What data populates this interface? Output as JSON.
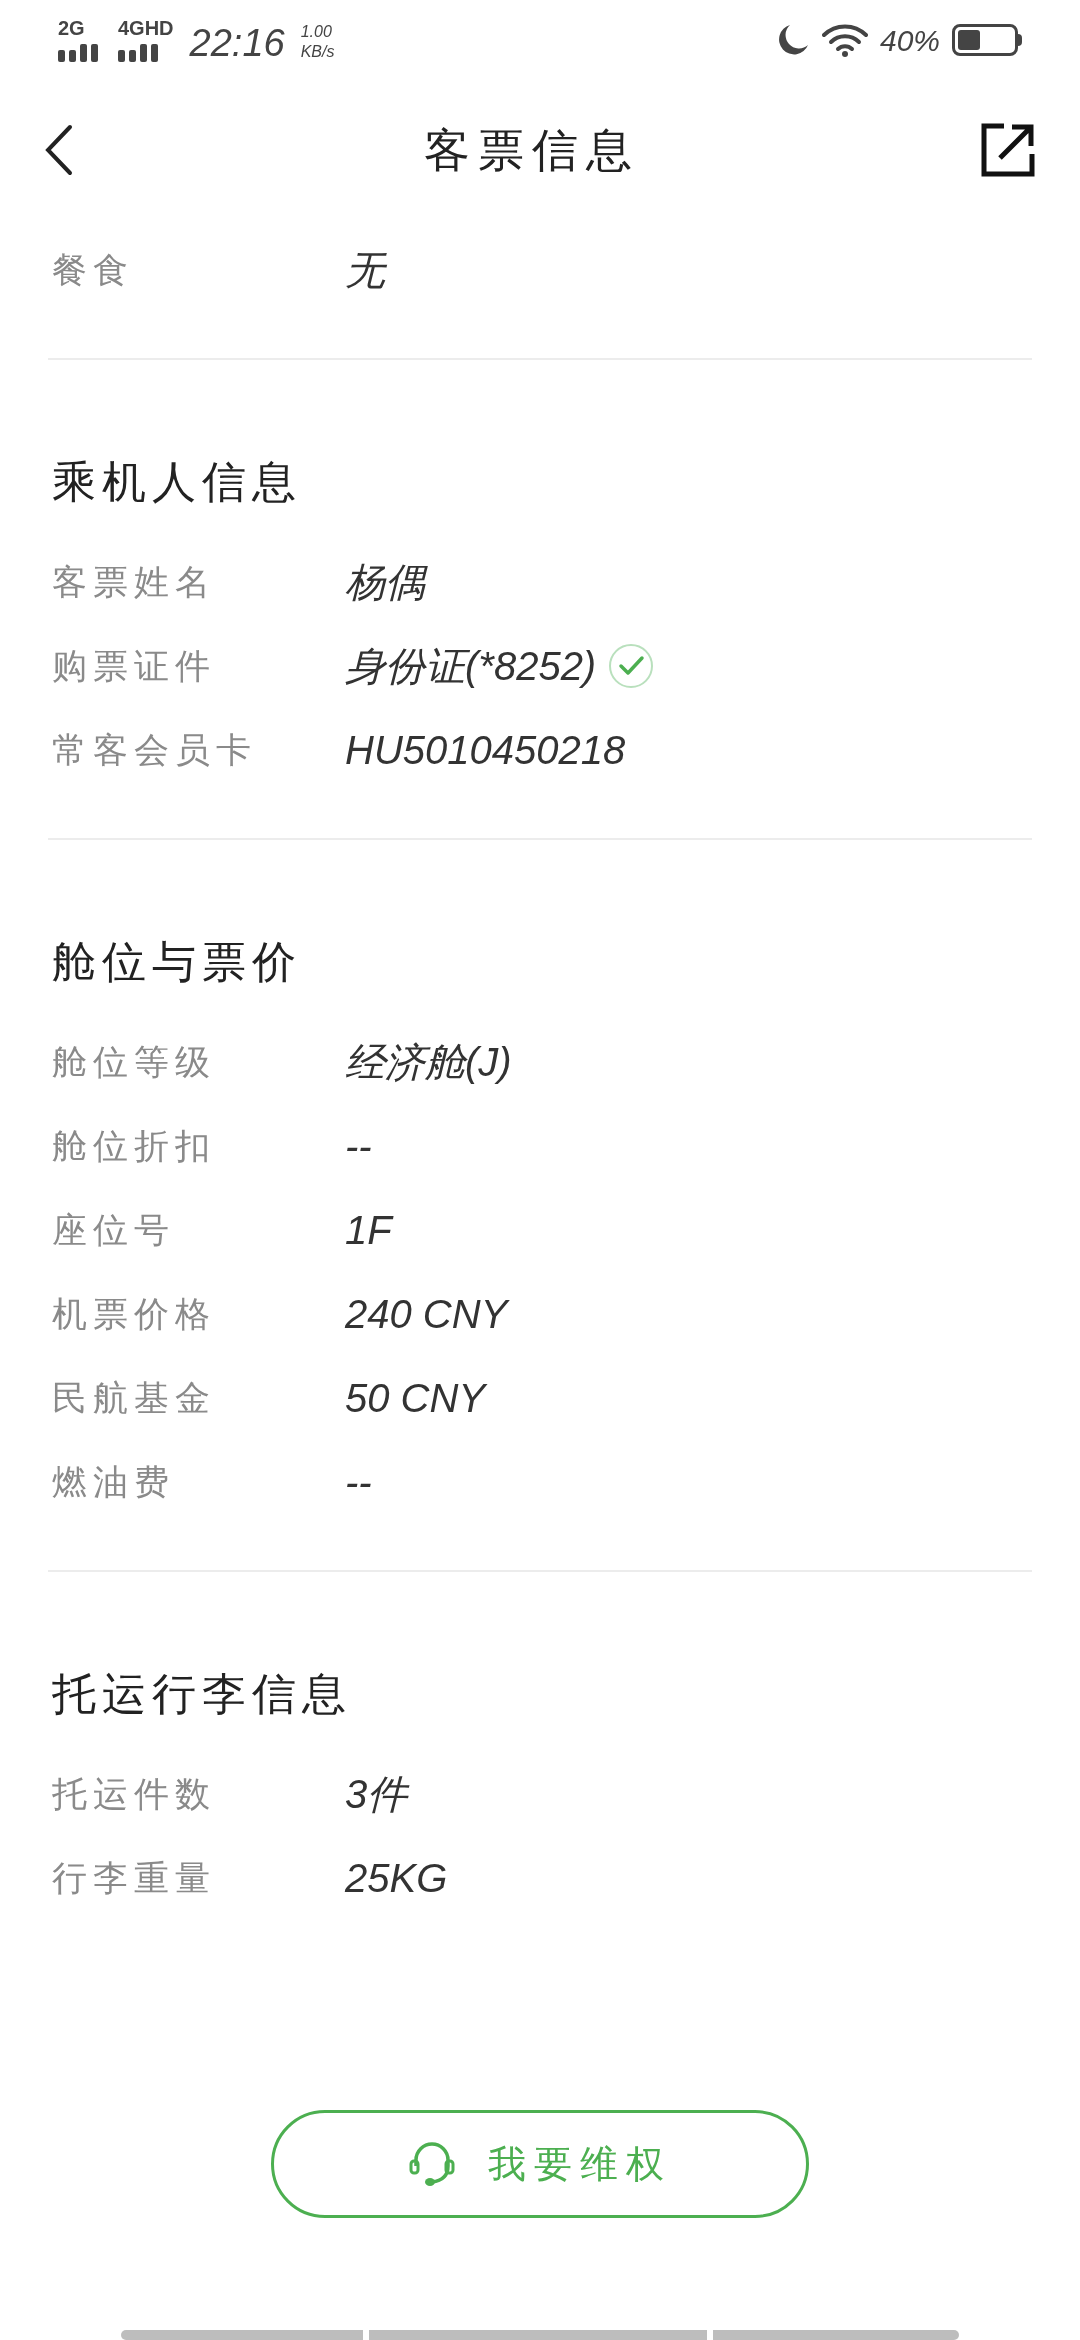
{
  "status_bar": {
    "network_1": "2G",
    "network_2": "4GHD",
    "time": "22:16",
    "speed_value": "1.00",
    "speed_unit": "KB/s",
    "battery": "40%"
  },
  "header": {
    "title": "客票信息"
  },
  "sections": [
    {
      "rows": [
        {
          "label": "餐食",
          "value": "无",
          "verified": false
        }
      ]
    },
    {
      "title": "乘机人信息",
      "rows": [
        {
          "label": "客票姓名",
          "value": "杨偶",
          "verified": false
        },
        {
          "label": "购票证件",
          "value": "身份证(*8252)",
          "verified": true
        },
        {
          "label": "常客会员卡",
          "value": "HU5010450218",
          "verified": false
        }
      ]
    },
    {
      "title": "舱位与票价",
      "rows": [
        {
          "label": "舱位等级",
          "value": "经济舱(J)",
          "verified": false
        },
        {
          "label": "舱位折扣",
          "value": "--",
          "verified": false
        },
        {
          "label": "座位号",
          "value": "1F",
          "verified": false
        },
        {
          "label": "机票价格",
          "value": "240 CNY",
          "verified": false
        },
        {
          "label": "民航基金",
          "value": "50 CNY",
          "verified": false
        },
        {
          "label": "燃油费",
          "value": "--",
          "verified": false
        }
      ]
    },
    {
      "title": "托运行李信息",
      "rows": [
        {
          "label": "托运件数",
          "value": "3件",
          "verified": false
        },
        {
          "label": "行李重量",
          "value": "25KG",
          "verified": false
        }
      ]
    }
  ],
  "action_button": {
    "label": "我要维权"
  }
}
